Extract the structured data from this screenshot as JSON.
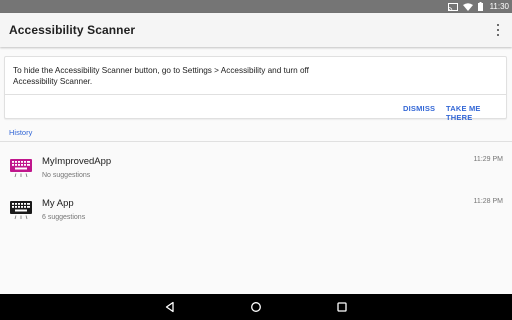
{
  "status_bar": {
    "time": "11:30",
    "icons": [
      "cast-icon",
      "wifi-icon",
      "battery-icon"
    ]
  },
  "app_bar": {
    "title": "Accessibility Scanner",
    "menu_icon": "overflow-menu-icon"
  },
  "banner": {
    "message_line1": "To hide the Accessibility Scanner button, go to Settings > Accessibility and turn off",
    "message_line2": "Accessibility Scanner.",
    "dismiss_label": "DISMISS",
    "take_me_label": "TAKE ME THERE"
  },
  "history": {
    "label": "History",
    "items": [
      {
        "name": "MyImprovedApp",
        "subtitle": "No suggestions",
        "time": "11:29 PM",
        "icon": "keyboard-icon",
        "icon_color": "#c0168c"
      },
      {
        "name": "My App",
        "subtitle": "6 suggestions",
        "time": "11:28 PM",
        "icon": "keyboard-icon",
        "icon_color": "#1a1a1a"
      }
    ]
  },
  "nav_bar": {
    "buttons": [
      "back-icon",
      "home-icon",
      "recents-icon"
    ]
  },
  "colors": {
    "accent": "#3367d6",
    "status_bar": "#757575",
    "app_bar": "#f5f5f5",
    "nav_bar": "#000000"
  }
}
